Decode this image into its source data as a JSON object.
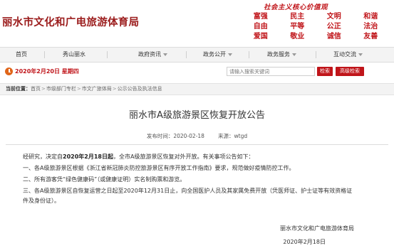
{
  "header": {
    "site_title": "丽水市文化和广电旅游体育局",
    "values_slogan": "社会主义核心价值观",
    "values": [
      [
        "富强",
        "民主",
        "文明",
        "和谐"
      ],
      [
        "自由",
        "平等",
        "公正",
        "法治"
      ],
      [
        "爱国",
        "敬业",
        "诚信",
        "友善"
      ]
    ]
  },
  "nav": {
    "items": [
      {
        "label": "首页",
        "dropdown": false
      },
      {
        "label": "秀山丽水",
        "dropdown": false
      },
      {
        "label": "政府资讯",
        "dropdown": true
      },
      {
        "label": "政务公开",
        "dropdown": true
      },
      {
        "label": "政务服务",
        "dropdown": true
      },
      {
        "label": "互动交流",
        "dropdown": true
      }
    ]
  },
  "toolbar": {
    "date": "2020年2月20日 星期四",
    "search_placeholder": "请输入搜索关键词",
    "search_label": "检索",
    "advanced_search_label": "高级检索"
  },
  "breadcrumb": {
    "label": "当前位置：",
    "items": [
      "首页",
      "市级部门专栏",
      "市文广旅体局",
      "公示公告及执法信息"
    ]
  },
  "article": {
    "title": "丽水市A级旅游景区恢复开放公告",
    "date_label": "发布时间：",
    "date": "2020-02-18",
    "source_label": "来源：",
    "source": "wtgd",
    "intro_pre": "经研究，决定自",
    "intro_bold": "2020年2月18日起",
    "intro_post": "，全市A级旅游景区恢复对外开放。有关事项公告如下：",
    "items": [
      "一、各A级旅游景区根据《浙江省新冠肺炎防控旅游景区有序开放工作指南》要求，规范做好疫情防控工作。",
      "二、所有游客凭“绿色健康码”（或健康证明）实名制购票和游览。",
      "三、各A级旅游景区自恢复运营之日起至2020年12月31日止，向全国医护人员及其家属免费开放（凭医师证、护士证等有效资格证件及身份证）。"
    ],
    "signature": "丽水市文化和广电旅游体育局",
    "sign_date": "2020年2月18日"
  }
}
